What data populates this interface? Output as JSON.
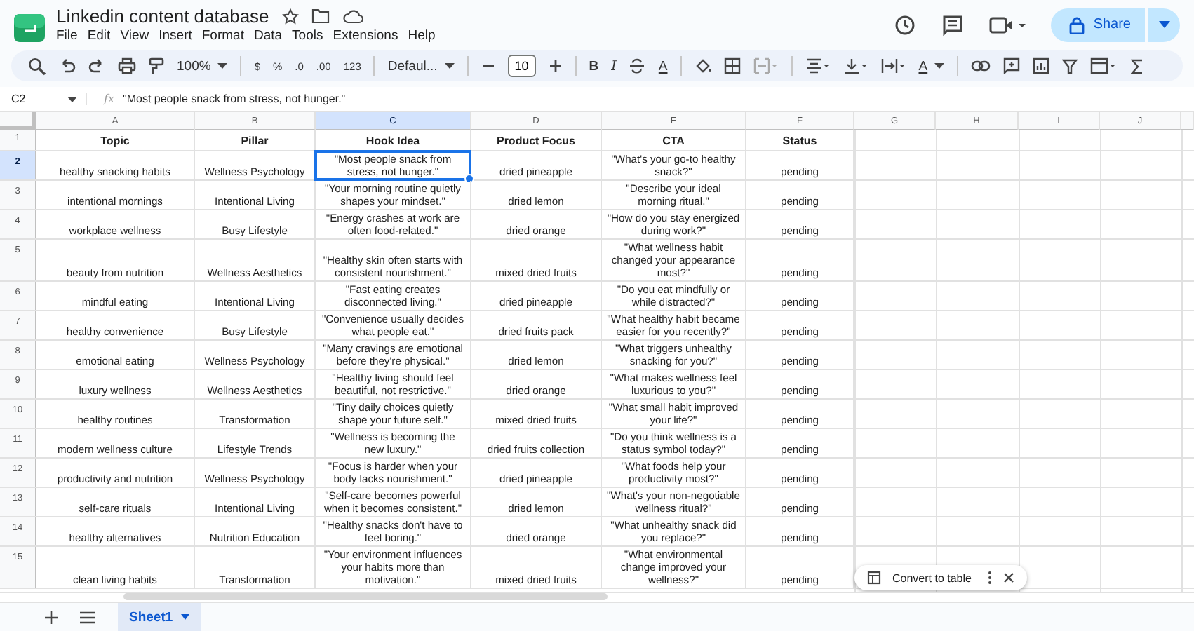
{
  "document": {
    "title": "Linkedin content database",
    "menus": [
      "File",
      "Edit",
      "View",
      "Insert",
      "Format",
      "Data",
      "Tools",
      "Extensions",
      "Help"
    ],
    "share_label": "Share"
  },
  "toolbar": {
    "zoom": "100%",
    "currency": "$",
    "percent": "%",
    "decrease_decimals": ".0",
    "increase_decimals": ".00",
    "number_format": "123",
    "font": "Defaul...",
    "font_size": "10",
    "bold": "B",
    "italic": "I",
    "text_color": "A",
    "text_rotation": "A"
  },
  "formula_bar": {
    "name_box": "C2",
    "fx": "fx",
    "value": "\"Most people snack from stress, not hunger.\""
  },
  "columns": [
    {
      "letter": "A",
      "selected": false
    },
    {
      "letter": "B",
      "selected": false
    },
    {
      "letter": "C",
      "selected": true
    },
    {
      "letter": "D",
      "selected": false
    },
    {
      "letter": "E",
      "selected": false
    },
    {
      "letter": "F",
      "selected": false
    },
    {
      "letter": "G",
      "selected": false
    },
    {
      "letter": "H",
      "selected": false
    },
    {
      "letter": "I",
      "selected": false
    },
    {
      "letter": "J",
      "selected": false
    }
  ],
  "rows": [
    {
      "number": "1",
      "selected": false,
      "header": true,
      "cells": [
        "Topic",
        "Pillar",
        "Hook Idea",
        "Product Focus",
        "CTA",
        "Status"
      ]
    },
    {
      "number": "2",
      "selected": true,
      "header": false,
      "cells": [
        "healthy snacking habits",
        "Wellness Psychology",
        "\"Most people snack from stress, not hunger.\"",
        "dried pineapple",
        "\"What's your go-to healthy snack?\"",
        "pending"
      ]
    },
    {
      "number": "3",
      "selected": false,
      "header": false,
      "cells": [
        "intentional mornings",
        "Intentional Living",
        "\"Your morning routine quietly shapes your mindset.\"",
        "dried lemon",
        "\"Describe your ideal morning ritual.\"",
        "pending"
      ]
    },
    {
      "number": "4",
      "selected": false,
      "header": false,
      "cells": [
        "workplace wellness",
        "Busy Lifestyle",
        "\"Energy crashes at work are often food-related.\"",
        "dried orange",
        "\"How do you stay energized during work?\"",
        "pending"
      ]
    },
    {
      "number": "5",
      "selected": false,
      "header": false,
      "cells": [
        "beauty from nutrition",
        "Wellness Aesthetics",
        "\"Healthy skin often starts with consistent nourishment.\"",
        "mixed dried fruits",
        "\"What wellness habit changed your appearance most?\"",
        "pending"
      ]
    },
    {
      "number": "6",
      "selected": false,
      "header": false,
      "cells": [
        "mindful eating",
        "Intentional Living",
        "\"Fast eating creates disconnected living.\"",
        "dried pineapple",
        "\"Do you eat mindfully or while distracted?\"",
        "pending"
      ]
    },
    {
      "number": "7",
      "selected": false,
      "header": false,
      "cells": [
        "healthy convenience",
        "Busy Lifestyle",
        "\"Convenience usually decides what people eat.\"",
        "dried fruits pack",
        "\"What healthy habit became easier for you recently?\"",
        "pending"
      ]
    },
    {
      "number": "8",
      "selected": false,
      "header": false,
      "cells": [
        "emotional eating",
        "Wellness Psychology",
        "\"Many cravings are emotional before they're physical.\"",
        "dried lemon",
        "\"What triggers unhealthy snacking for you?\"",
        "pending"
      ]
    },
    {
      "number": "9",
      "selected": false,
      "header": false,
      "cells": [
        "luxury wellness",
        "Wellness Aesthetics",
        "\"Healthy living should feel beautiful, not restrictive.\"",
        "dried orange",
        "\"What makes wellness feel luxurious to you?\"",
        "pending"
      ]
    },
    {
      "number": "10",
      "selected": false,
      "header": false,
      "cells": [
        "healthy routines",
        "Transformation",
        "\"Tiny daily choices quietly shape your future self.\"",
        "mixed dried fruits",
        "\"What small habit improved your life?\"",
        "pending"
      ]
    },
    {
      "number": "11",
      "selected": false,
      "header": false,
      "cells": [
        "modern wellness culture",
        "Lifestyle Trends",
        "\"Wellness is becoming the new luxury.\"",
        "dried fruits collection",
        "\"Do you think wellness is a status symbol today?\"",
        "pending"
      ]
    },
    {
      "number": "12",
      "selected": false,
      "header": false,
      "cells": [
        "productivity and nutrition",
        "Wellness Psychology",
        "\"Focus is harder when your body lacks nourishment.\"",
        "dried pineapple",
        "\"What foods help your productivity most?\"",
        "pending"
      ]
    },
    {
      "number": "13",
      "selected": false,
      "header": false,
      "cells": [
        "self-care rituals",
        "Intentional Living",
        "\"Self-care becomes powerful when it becomes consistent.\"",
        "dried lemon",
        "\"What's your non-negotiable wellness ritual?\"",
        "pending"
      ]
    },
    {
      "number": "14",
      "selected": false,
      "header": false,
      "cells": [
        "healthy alternatives",
        "Nutrition Education",
        "\"Healthy snacks don't have to feel boring.\"",
        "dried orange",
        "\"What unhealthy snack did you replace?\"",
        "pending"
      ]
    },
    {
      "number": "15",
      "selected": false,
      "header": false,
      "cells": [
        "clean living habits",
        "Transformation",
        "\"Your environment influences your habits more than motivation.\"",
        "mixed dried fruits",
        "\"What environmental change improved your wellness?\"",
        "pending"
      ]
    }
  ],
  "chip": {
    "label": "Convert to table"
  },
  "sheets": [
    {
      "name": "Sheet1",
      "selected": true
    }
  ]
}
